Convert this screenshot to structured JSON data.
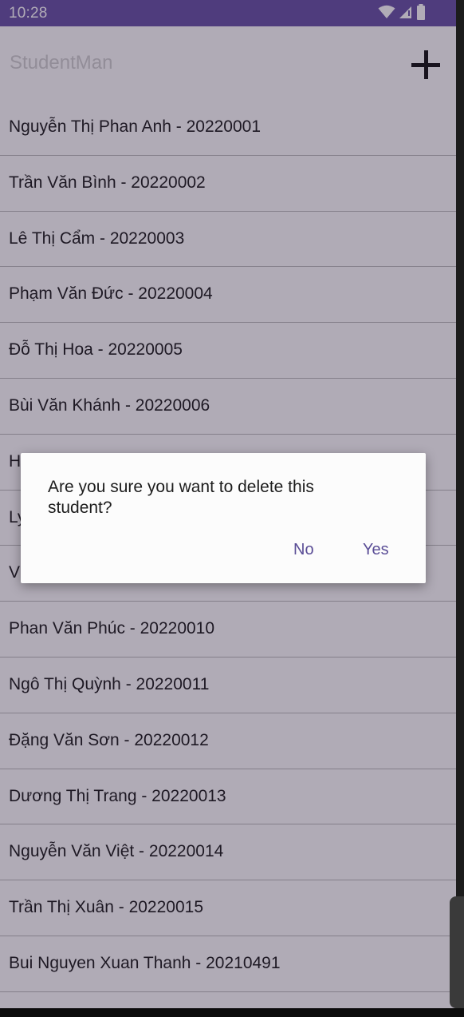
{
  "status_bar": {
    "time": "10:28",
    "icons": [
      "wifi-icon",
      "signal-icon",
      "battery-icon"
    ]
  },
  "app_bar": {
    "title": "StudentMan",
    "add_icon": "plus-icon"
  },
  "students": [
    "Nguyễn Thị Phan Anh - 20220001",
    "Trần Văn Bình - 20220002",
    "Lê Thị Cẩm - 20220003",
    "Phạm Văn Đức - 20220004",
    "Đỗ Thị Hoa - 20220005",
    "Bùi Văn Khánh - 20220006",
    "H",
    "Ly",
    "V",
    "Phan Văn Phúc - 20220010",
    "Ngô Thị Quỳnh - 20220011",
    "Đặng Văn Sơn - 20220012",
    "Dương Thị Trang - 20220013",
    "Nguyễn Văn Việt - 20220014",
    "Trần Thị Xuân - 20220015",
    "Bui Nguyen Xuan Thanh - 20210491"
  ],
  "dialog": {
    "message": "Are you sure you want to delete this student?",
    "no_label": "No",
    "yes_label": "Yes"
  },
  "colors": {
    "status_bar": "#6750a4",
    "dialog_button": "#5a4d96",
    "scrim": "#261a38"
  }
}
